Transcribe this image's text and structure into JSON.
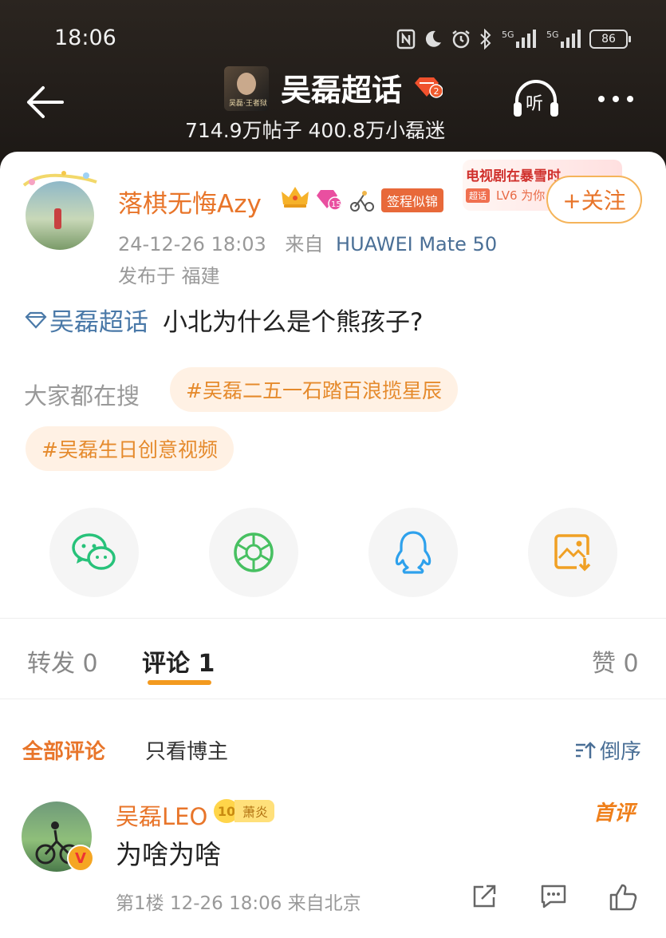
{
  "status_bar": {
    "time": "18:06",
    "battery": "86",
    "icons": [
      "nfc-icon",
      "moon-icon",
      "alarm-icon",
      "bluetooth-icon",
      "signal-5g-icon",
      "signal-5g-icon",
      "battery-icon"
    ]
  },
  "header": {
    "topic_title": "吴磊超话",
    "topic_level_badge": "2",
    "thumb_text": "吴磊·王者狱",
    "stats": "714.9万帖子 400.8万小磊迷",
    "listen_label": "听"
  },
  "author": {
    "name": "落棋无悔Azy",
    "level": "15",
    "sign_tag": "签程似锦",
    "date": "24-12-26 18:03",
    "source_prefix": "来自",
    "device": "HUAWEI Mate 50",
    "location": "发布于 福建",
    "follow_label": "+关注"
  },
  "ad": {
    "title": "电视剧在暴雪时",
    "chip": "超话",
    "subtitle": "LV6 为你"
  },
  "post": {
    "hashtag": "吴磊超话",
    "text": "小北为什么是个熊孩子?"
  },
  "searching": {
    "label": "大家都在搜",
    "tags": [
      "#吴磊二五一石踏百浪揽星辰",
      "#吴磊生日创意视频"
    ]
  },
  "share": {
    "icons": [
      "wechat-icon",
      "moments-icon",
      "qq-icon",
      "save-image-icon"
    ]
  },
  "tabs": {
    "repost": "转发 0",
    "comments": "评论 1",
    "likes": "赞 0"
  },
  "sort": {
    "all": "全部评论",
    "owner_only": "只看博主",
    "order": "倒序"
  },
  "comment": {
    "name": "吴磊LEO",
    "level": "10",
    "fan_tag": "萧炎",
    "first_badge": "首评",
    "verified": "V",
    "text": "为啥为啥",
    "meta": "第1楼 12-26 18:06 来自北京"
  },
  "colors": {
    "accent": "#e8752a",
    "link": "#4a79a8",
    "chip_bg": "#fff1e4",
    "tab_underline": "#f39a1f"
  }
}
